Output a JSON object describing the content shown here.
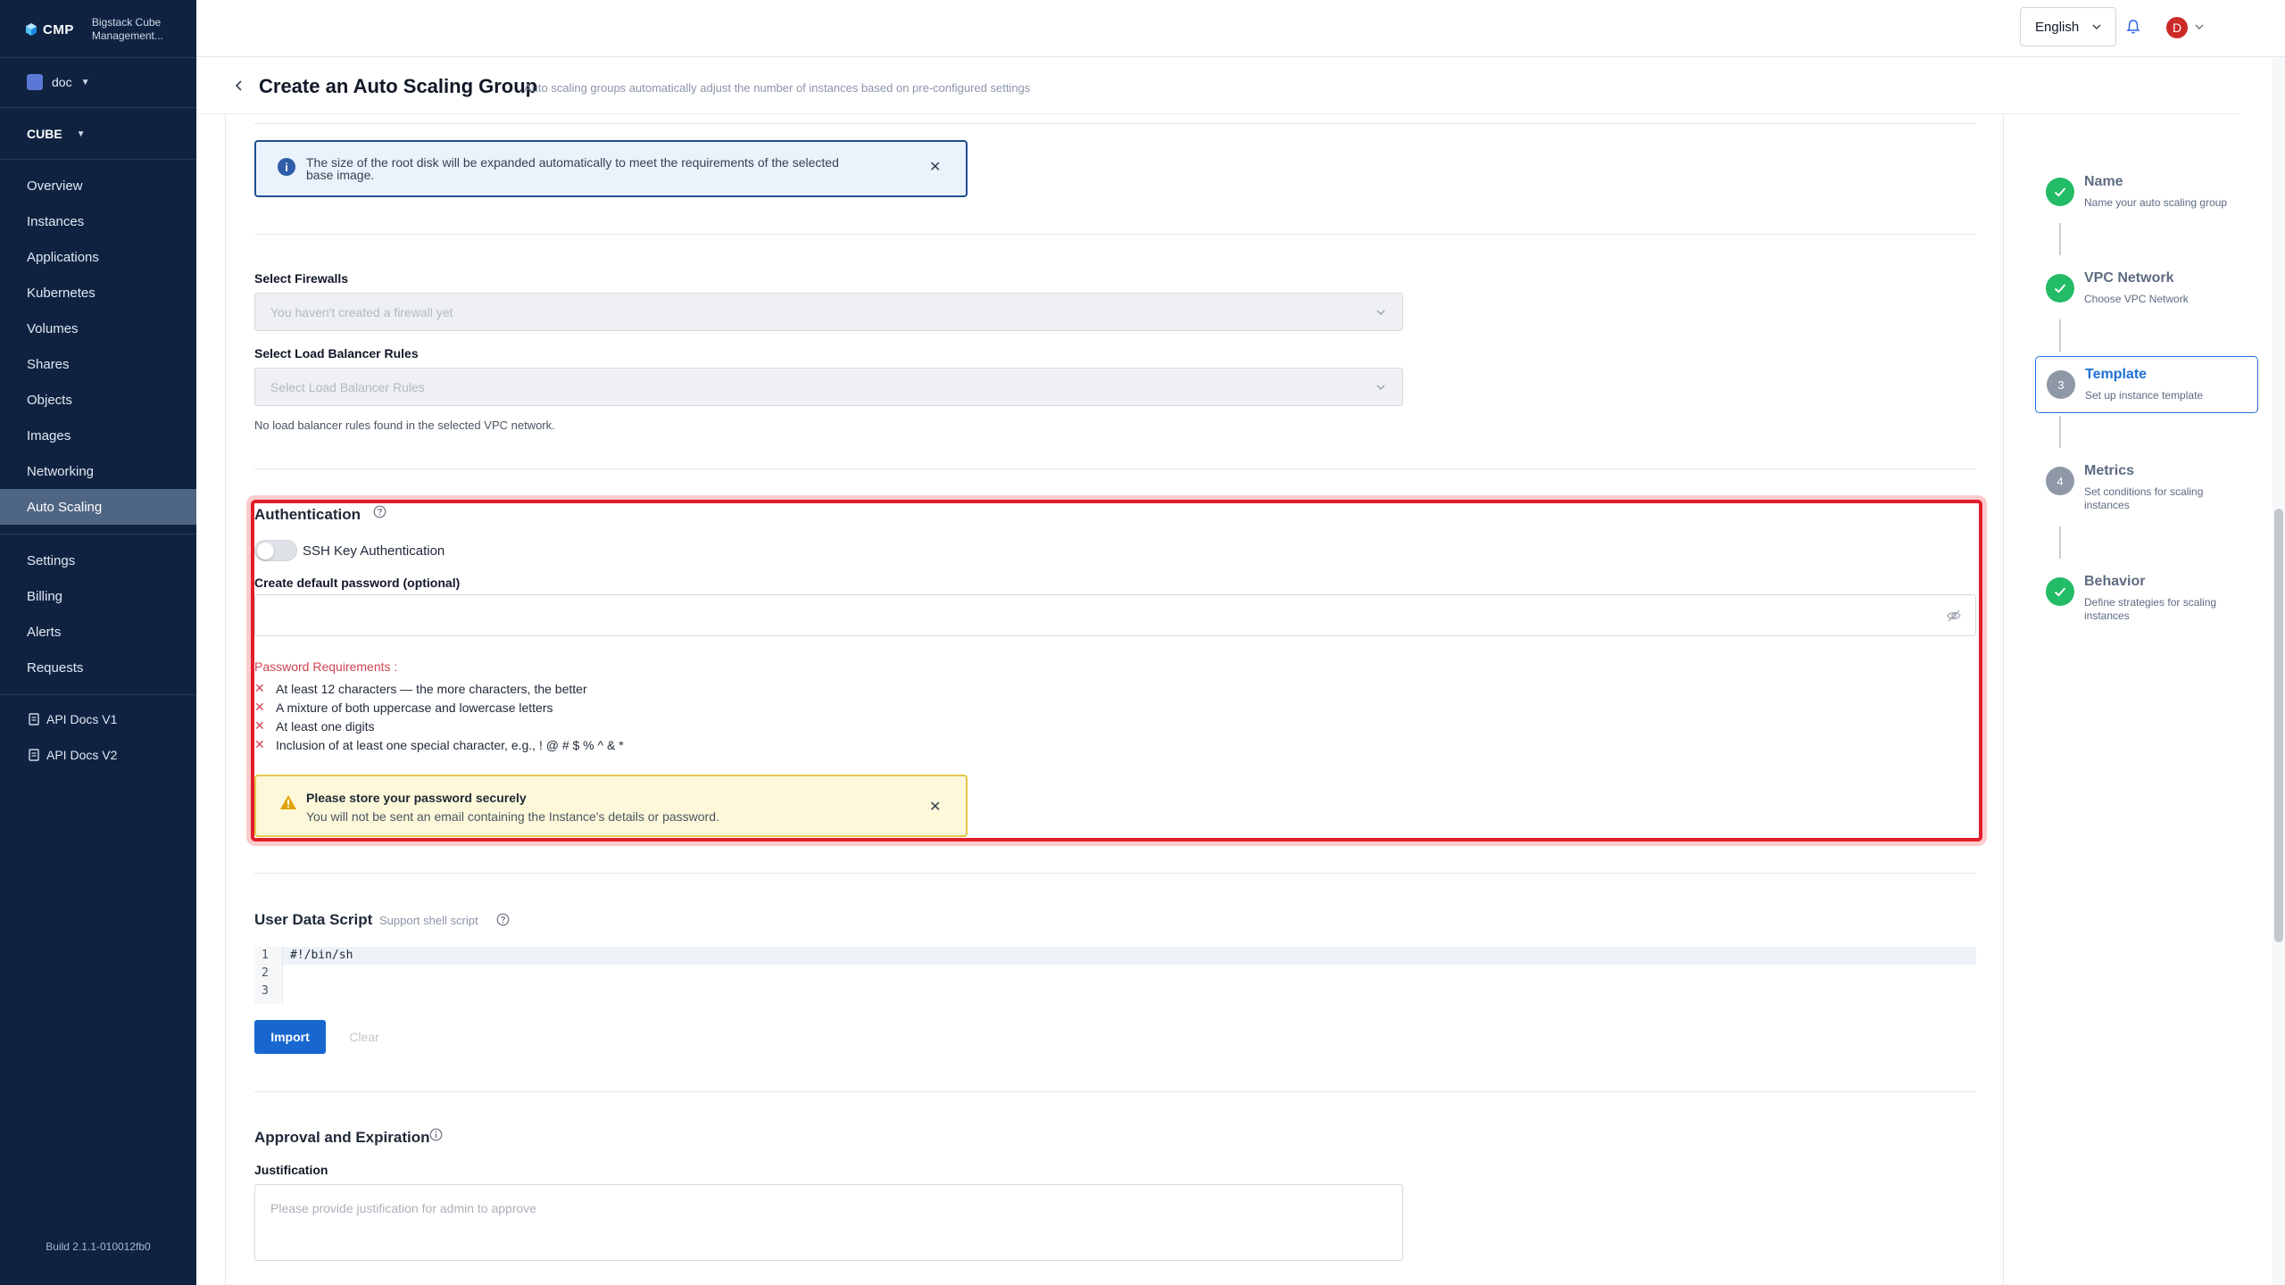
{
  "brand": {
    "logo_text": "CMP",
    "name_line1": "Bigstack Cube",
    "name_line2": "Management..."
  },
  "project": {
    "name": "doc"
  },
  "region": {
    "name": "CUBE"
  },
  "sidebar": {
    "items": [
      {
        "label": "Overview"
      },
      {
        "label": "Instances"
      },
      {
        "label": "Applications"
      },
      {
        "label": "Kubernetes"
      },
      {
        "label": "Volumes"
      },
      {
        "label": "Shares"
      },
      {
        "label": "Objects"
      },
      {
        "label": "Images"
      },
      {
        "label": "Networking"
      },
      {
        "label": "Auto Scaling"
      }
    ],
    "admin_items": [
      {
        "label": "Settings"
      },
      {
        "label": "Billing"
      },
      {
        "label": "Alerts"
      },
      {
        "label": "Requests"
      }
    ],
    "docs": [
      {
        "label": "API Docs V1"
      },
      {
        "label": "API Docs V2"
      }
    ],
    "build": "Build 2.1.1-010012fb0"
  },
  "topbar": {
    "language": "English",
    "avatar_initial": "D"
  },
  "header": {
    "title": "Create an Auto Scaling Group",
    "subtitle": "Auto scaling groups automatically adjust the number of instances based on pre-configured settings"
  },
  "form": {
    "info_banner": "The size of the root disk will be expanded automatically to meet the requirements of the selected base image.",
    "firewalls_label": "Select Firewalls",
    "firewalls_placeholder": "You haven't created a firewall yet",
    "lb_label": "Select Load Balancer Rules",
    "lb_placeholder": "Select Load Balancer Rules",
    "lb_hint": "No load balancer rules found in the selected VPC network.",
    "auth": {
      "title": "Authentication",
      "ssh_label": "SSH Key Authentication",
      "ssh_enabled": false,
      "password_label": "Create default password (optional)",
      "password_value": "",
      "requirements_title": "Password Requirements :",
      "requirements": [
        "At least 12 characters — the more characters, the better",
        "A mixture of both uppercase and lowercase letters",
        "At least one digits",
        "Inclusion of at least one special character, e.g., ! @ # $ % ^ & *"
      ],
      "warning_title": "Please store your password securely",
      "warning_text": "You will not be sent an email containing the Instance's details or password."
    },
    "user_data": {
      "title": "User Data Script",
      "subtitle": "Support shell script",
      "line_numbers": [
        "1",
        "2",
        "3"
      ],
      "code": "#!/bin/sh",
      "import_label": "Import",
      "clear_label": "Clear"
    },
    "approval": {
      "title": "Approval and Expiration",
      "justification_label": "Justification",
      "justification_placeholder": "Please provide justification for admin to approve"
    }
  },
  "steps": [
    {
      "title": "Name",
      "subtitle": "Name your auto scaling group",
      "state": "done"
    },
    {
      "title": "VPC Network",
      "subtitle": "Choose VPC Network",
      "state": "done"
    },
    {
      "title": "Template",
      "subtitle": "Set up instance template",
      "state": "active",
      "number": "3"
    },
    {
      "title": "Metrics",
      "subtitle": "Set conditions for scaling instances",
      "state": "pending",
      "number": "4"
    },
    {
      "title": "Behavior",
      "subtitle": "Define strategies for scaling instances",
      "state": "done"
    }
  ],
  "colors": {
    "sidebar_bg": "#0f2341",
    "sidebar_active": "#4f6584",
    "primary": "#1867d1",
    "success": "#22bb66",
    "highlight": "#e11d2a",
    "warning_bg": "#fdf8d9",
    "info_bg": "#eaf2fb"
  }
}
